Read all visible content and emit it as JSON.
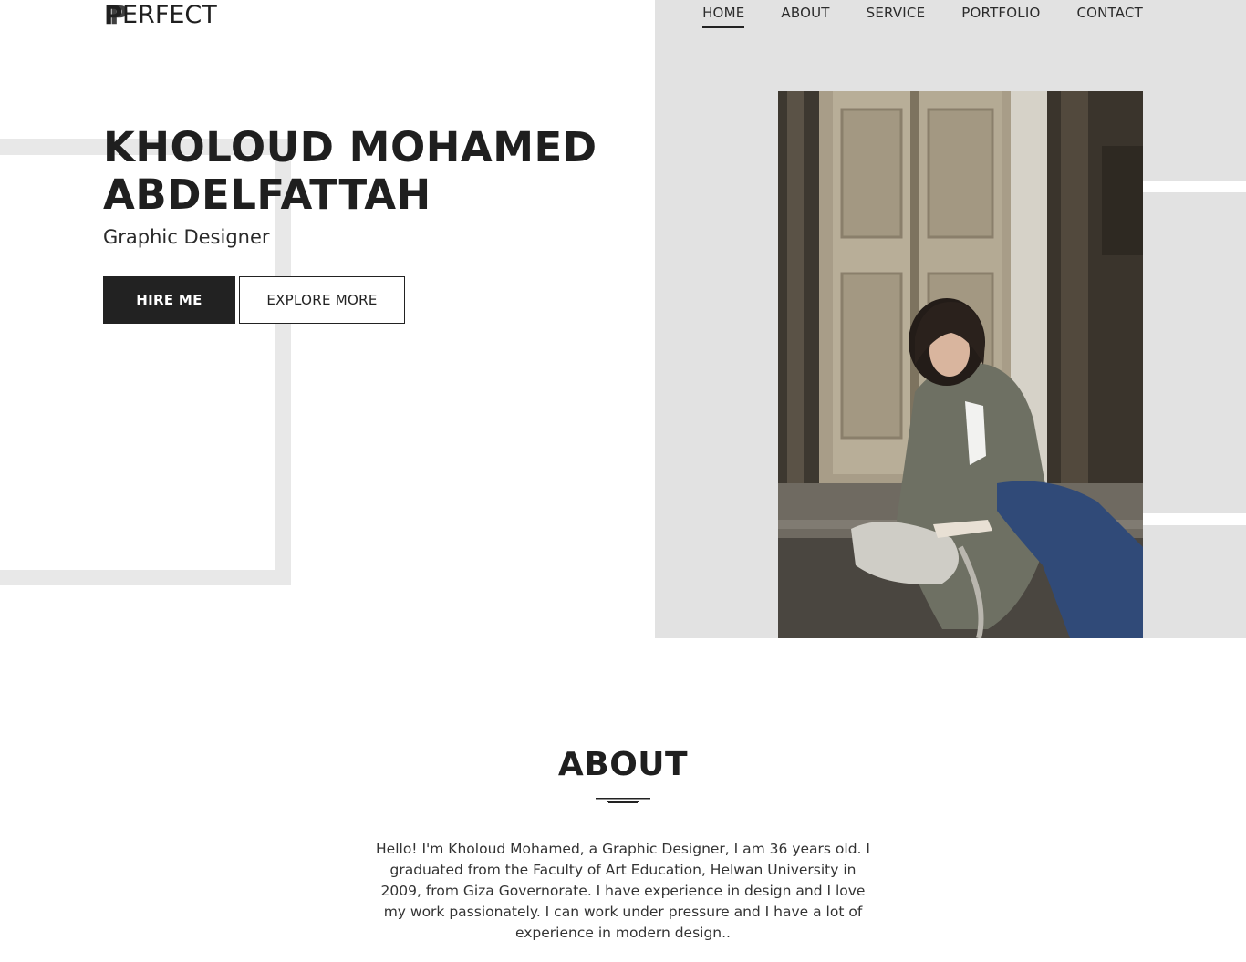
{
  "logo": {
    "mark": "P",
    "text": "ERFECT"
  },
  "nav": {
    "items": [
      {
        "label": "HOME",
        "active": true
      },
      {
        "label": "ABOUT",
        "active": false
      },
      {
        "label": "SERVICE",
        "active": false
      },
      {
        "label": "PORTFOLIO",
        "active": false
      },
      {
        "label": "CONTACT",
        "active": false
      }
    ]
  },
  "hero": {
    "name_line1": "KHOLOUD MOHAMED",
    "name_line2": "ABDELFATTAH",
    "role": "Graphic Designer",
    "hire_label": "HIRE ME",
    "explore_label": "EXPLORE MORE"
  },
  "about": {
    "title": "ABOUT",
    "text": "Hello! I'm Kholoud Mohamed, a Graphic Designer, I am 36 years old. I graduated from the Faculty of Art Education, Helwan University in 2009, from Giza Governorate. I have experience in design and I love my work passionately. I can work under pressure and I have a lot of experience in modern design.."
  },
  "colors": {
    "panel": "#e2e2e2",
    "accent": "#222222"
  }
}
